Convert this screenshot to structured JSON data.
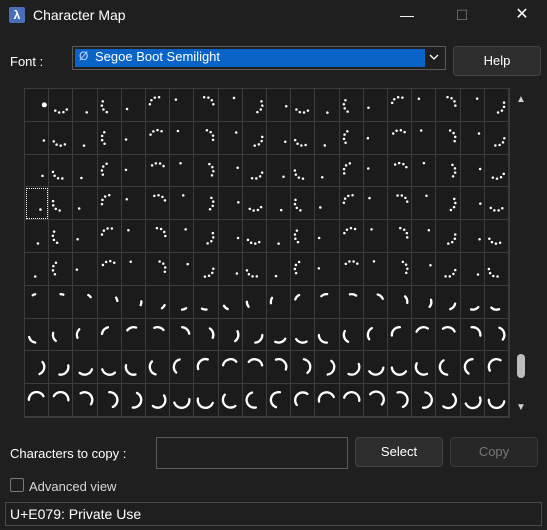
{
  "window": {
    "title": "Character Map",
    "minimize_glyph": "—",
    "maximize_glyph": "☐",
    "close_glyph": "✕",
    "icon": "charmap-app-icon"
  },
  "font": {
    "label": "Font :",
    "selected": "Segoe Boot Semilight",
    "icon": "opentype-font-icon"
  },
  "buttons": {
    "help": "Help",
    "select": "Select",
    "copy": "Copy"
  },
  "copy_field": {
    "label": "Characters to copy :",
    "value": ""
  },
  "advanced_view": {
    "label": "Advanced view",
    "checked": false
  },
  "status": {
    "text": "U+E079: Private Use"
  },
  "grid": {
    "columns": 20,
    "rows": 10,
    "selected_cell": 60,
    "glyph_description": "boot spinner animation frames (dots and arcs)"
  },
  "colors": {
    "background": "#1f1f1f",
    "accent": "#0a64c8",
    "grid_line": "#3c3c3c",
    "glyph": "#ffffff"
  }
}
